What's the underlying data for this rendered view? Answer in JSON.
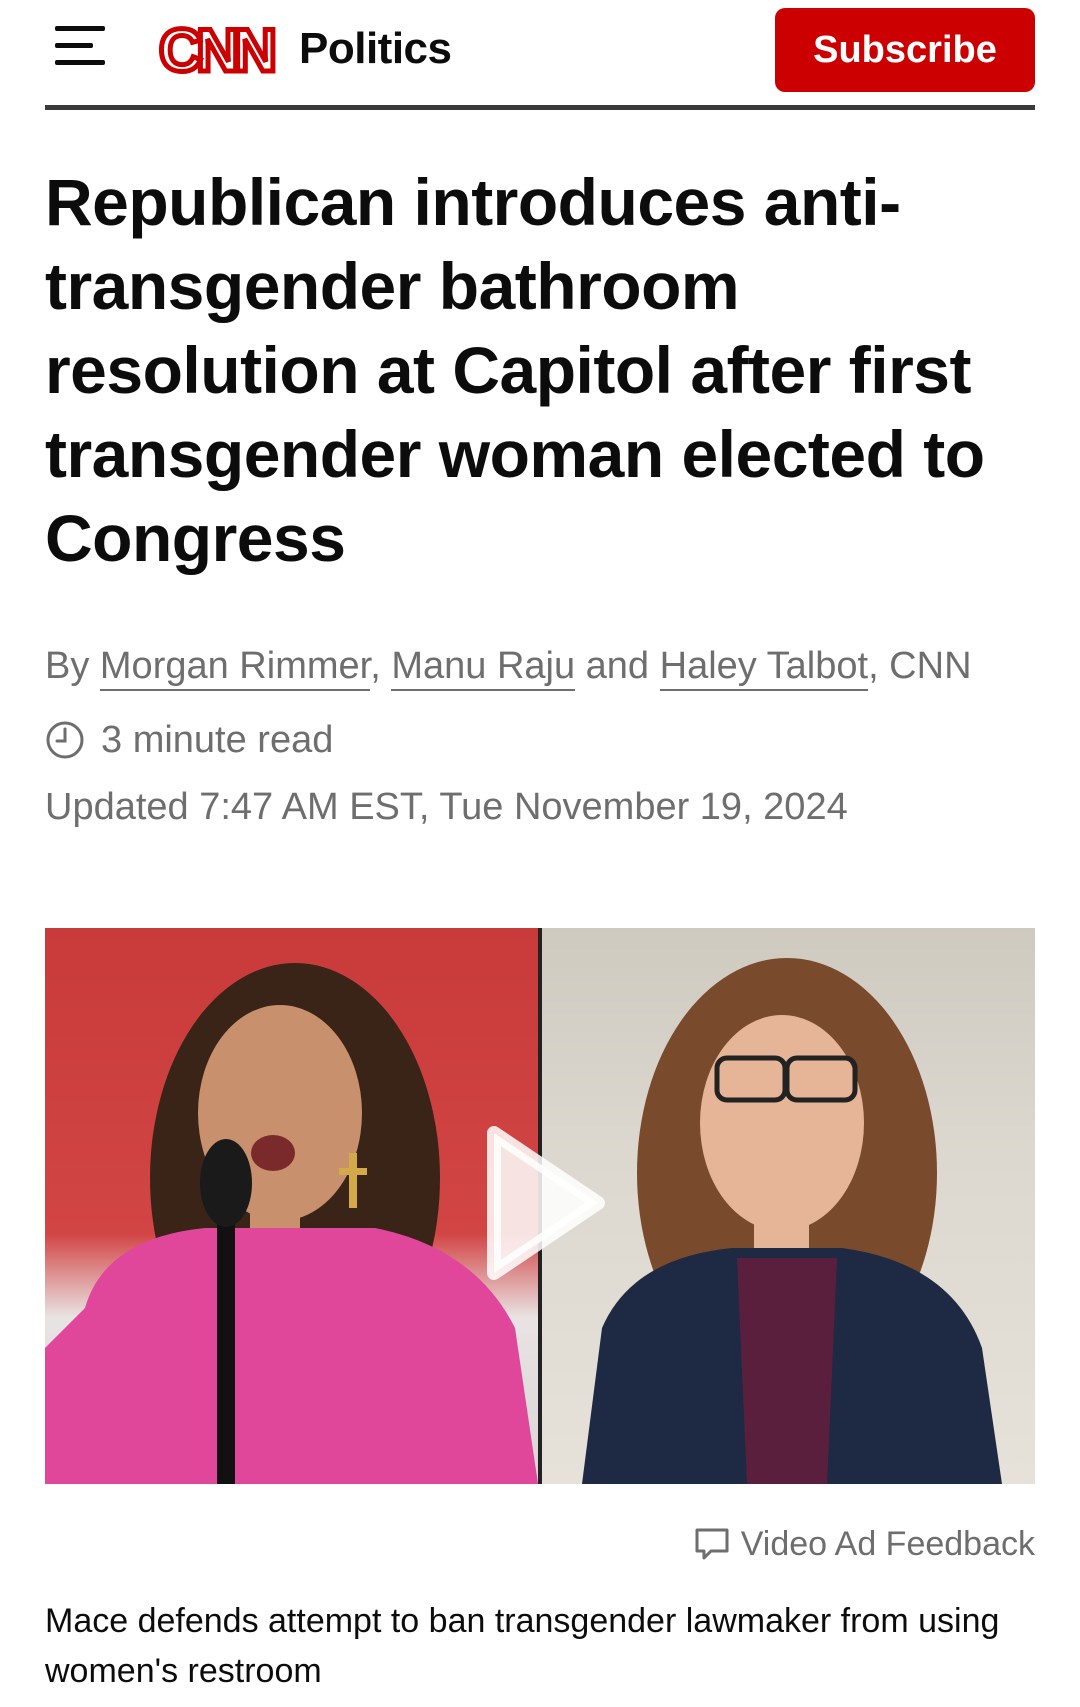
{
  "header": {
    "logo_text": "CNN",
    "section": "Politics",
    "subscribe_label": "Subscribe",
    "icons": {
      "menu": "hamburger-menu-icon"
    },
    "colors": {
      "brand_red": "#cc0000"
    }
  },
  "article": {
    "headline": "Republican introduces anti-transgender bathroom resolution at Capitol after first transgender woman elected to Congress",
    "byline": {
      "prefix": "By ",
      "authors": [
        "Morgan Rimmer",
        "Manu Raju",
        "Haley Talbot"
      ],
      "sep1": ", ",
      "sep2": " and ",
      "suffix": ", CNN"
    },
    "read_time": "3 minute read",
    "updated": "Updated 7:47 AM EST, Tue November 19, 2024",
    "video": {
      "ad_feedback_label": "Video Ad Feedback",
      "caption": "Mace defends attempt to ban transgender lawmaker from using women's restroom",
      "icons": {
        "play": "play-icon",
        "feedback": "feedback-icon"
      }
    }
  }
}
